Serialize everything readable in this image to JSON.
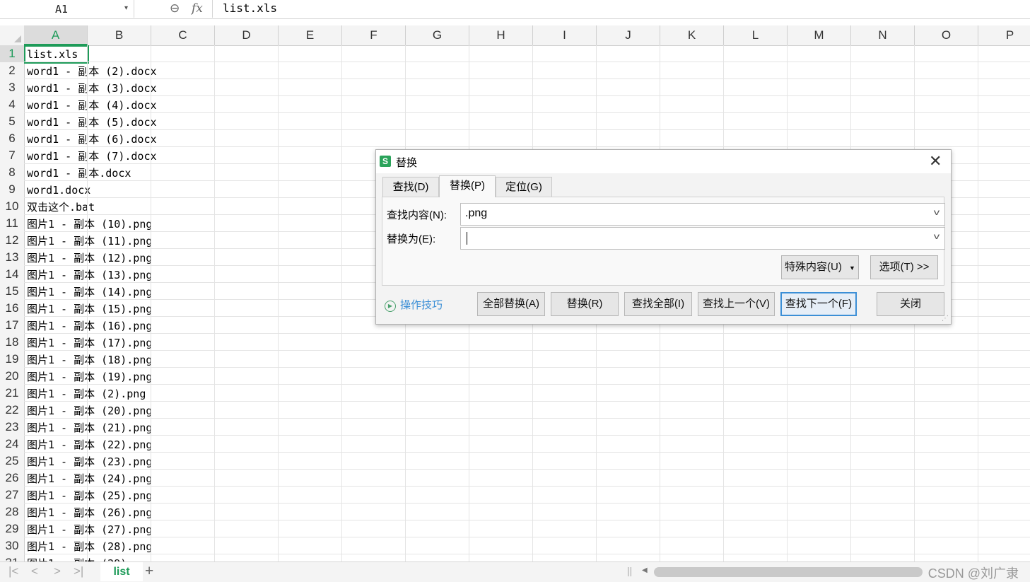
{
  "formula_bar": {
    "name_box": "A1",
    "zoom_icon": "zoom-icon",
    "fx_label": "fx",
    "content": "list.xls"
  },
  "columns": [
    "A",
    "B",
    "C",
    "D",
    "E",
    "F",
    "G",
    "H",
    "I",
    "J",
    "K",
    "L",
    "M",
    "N",
    "O",
    "P"
  ],
  "active_column": "A",
  "rows": [
    {
      "n": "1",
      "a": "list.xls"
    },
    {
      "n": "2",
      "a": "word1 - 副本 (2).docx"
    },
    {
      "n": "3",
      "a": "word1 - 副本 (3).docx"
    },
    {
      "n": "4",
      "a": "word1 - 副本 (4).docx"
    },
    {
      "n": "5",
      "a": "word1 - 副本 (5).docx"
    },
    {
      "n": "6",
      "a": "word1 - 副本 (6).docx"
    },
    {
      "n": "7",
      "a": "word1 - 副本 (7).docx"
    },
    {
      "n": "8",
      "a": "word1 - 副本.docx"
    },
    {
      "n": "9",
      "a": "word1.docx"
    },
    {
      "n": "10",
      "a": "双击这个.bat"
    },
    {
      "n": "11",
      "a": "图片1 - 副本 (10).png"
    },
    {
      "n": "12",
      "a": "图片1 - 副本 (11).png"
    },
    {
      "n": "13",
      "a": "图片1 - 副本 (12).png"
    },
    {
      "n": "14",
      "a": "图片1 - 副本 (13).png"
    },
    {
      "n": "15",
      "a": "图片1 - 副本 (14).png"
    },
    {
      "n": "16",
      "a": "图片1 - 副本 (15).png"
    },
    {
      "n": "17",
      "a": "图片1 - 副本 (16).png"
    },
    {
      "n": "18",
      "a": "图片1 - 副本 (17).png"
    },
    {
      "n": "19",
      "a": "图片1 - 副本 (18).png"
    },
    {
      "n": "20",
      "a": "图片1 - 副本 (19).png"
    },
    {
      "n": "21",
      "a": "图片1 - 副本 (2).png"
    },
    {
      "n": "22",
      "a": "图片1 - 副本 (20).png"
    },
    {
      "n": "23",
      "a": "图片1 - 副本 (21).png"
    },
    {
      "n": "24",
      "a": "图片1 - 副本 (22).png"
    },
    {
      "n": "25",
      "a": "图片1 - 副本 (23).png"
    },
    {
      "n": "26",
      "a": "图片1 - 副本 (24).png"
    },
    {
      "n": "27",
      "a": "图片1 - 副本 (25).png"
    },
    {
      "n": "28",
      "a": "图片1 - 副本 (26).png"
    },
    {
      "n": "29",
      "a": "图片1 - 副本 (27).png"
    },
    {
      "n": "30",
      "a": "图片1 - 副本 (28).png"
    },
    {
      "n": "31",
      "a": "图片1 - 副本 (29)"
    }
  ],
  "sheet_bar": {
    "sheet_name": "list",
    "add_label": "+",
    "watermark": "CSDN @刘广隶"
  },
  "dialog": {
    "title": "替换",
    "app_icon_letter": "S",
    "tabs": [
      {
        "label": "查找(D)",
        "active": false
      },
      {
        "label": "替换(P)",
        "active": true
      },
      {
        "label": "定位(G)",
        "active": false
      }
    ],
    "find_label": "查找内容(N):",
    "find_value": ".png",
    "replace_label": "替换为(E):",
    "replace_value": "",
    "special_button": "特殊内容(U)",
    "options_button": "选项(T) >>",
    "tips_label": "操作技巧",
    "buttons": {
      "replace_all": "全部替换(A)",
      "replace": "替换(R)",
      "find_all": "查找全部(I)",
      "find_prev": "查找上一个(V)",
      "find_next": "查找下一个(F)",
      "close": "关闭"
    },
    "accent_color": "#3c8fd6"
  },
  "colors": {
    "selection": "#1e9b59",
    "header_bg": "#f4f4f4"
  }
}
